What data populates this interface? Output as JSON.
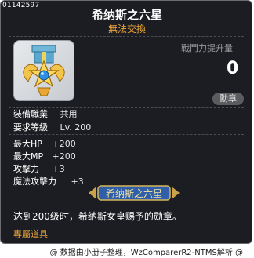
{
  "item_id": "01142597",
  "title": "希纳斯之六星",
  "trade_status": "無法交換",
  "power": {
    "label": "戰鬥力提升量",
    "value": "0"
  },
  "badge_label": "勳章",
  "requirements": [
    {
      "key": "裝備職業",
      "value": "共用"
    },
    {
      "key": "要求等級",
      "value": "Lv. 200"
    }
  ],
  "stats": [
    {
      "key": "最大HP",
      "value": "+200"
    },
    {
      "key": "最大MP",
      "value": "+200"
    },
    {
      "key": "攻擊力",
      "value": "+3"
    },
    {
      "key": "魔法攻擊力",
      "value": "+3"
    }
  ],
  "set_name": "希纳斯之六星",
  "description": "达到200级时，希纳斯女皇赐予的勋章。",
  "exclusive_label": "專屬道具",
  "footer": "@ 数据由小册子整理，WzComparerR2-NTMS解析 @",
  "colors": {
    "background": "#1b1d22",
    "accent": "#e8a23a",
    "text": "#ffffff"
  }
}
